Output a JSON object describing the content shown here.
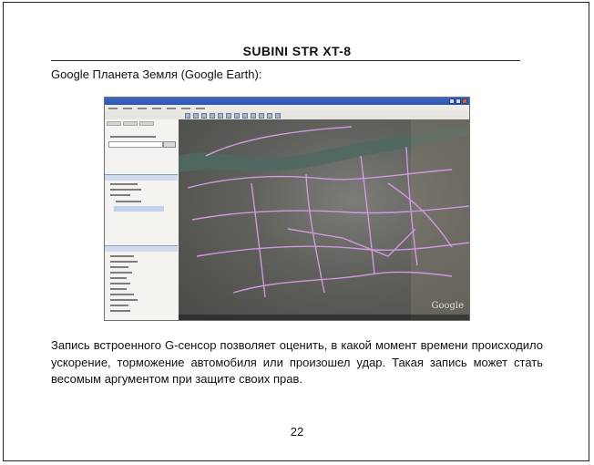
{
  "document": {
    "header_title": "SUBINI STR XT-8",
    "section_heading": "Google Планета Земля (Google Earth):",
    "body_text": "Запись встроенного G-сенсор позволяет оценить, в какой момент времени происходило ускорение, торможение автомобиля или произошел удар. Такая запись может стать весомым аргументом при защите своих прав.",
    "page_number": "22"
  },
  "screenshot": {
    "logo": "Google",
    "colors": {
      "titlebar": "#2b55b2",
      "map_background": "#5f605b",
      "river": "#4f6a62",
      "track": "#d59be6"
    }
  }
}
